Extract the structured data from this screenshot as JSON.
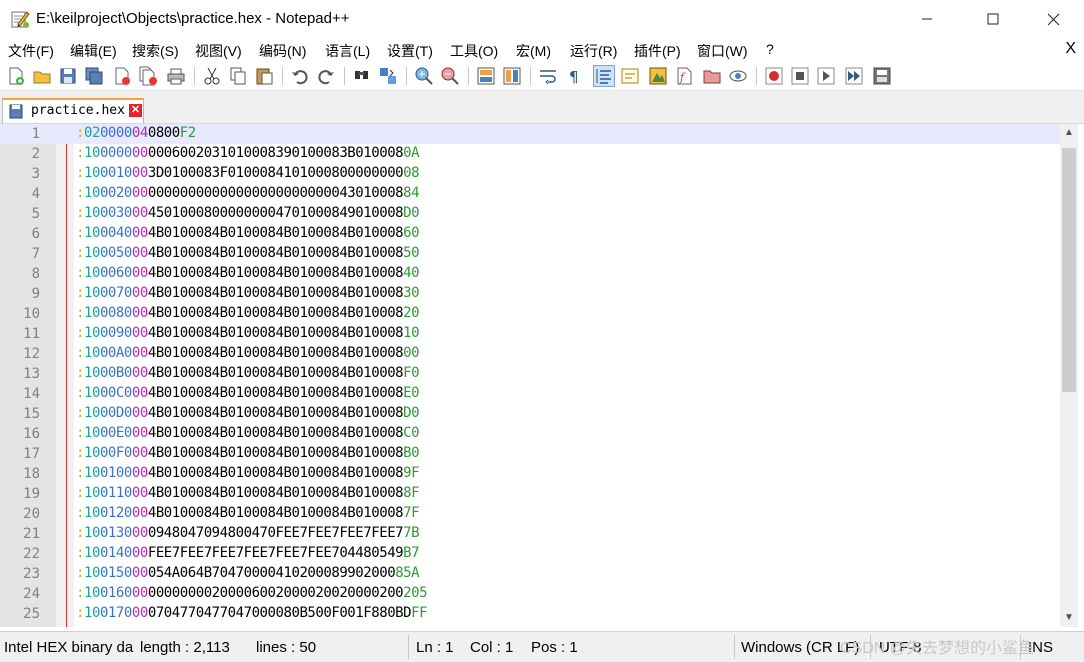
{
  "window": {
    "title": "E:\\keilproject\\Objects\\practice.hex - Notepad++",
    "minimize_glyph": "—",
    "maximize_glyph": "☐",
    "close_glyph": "✕"
  },
  "menu": {
    "items": [
      "文件(F)",
      "编辑(E)",
      "搜索(S)",
      "视图(V)",
      "编码(N)",
      "语言(L)",
      "设置(T)",
      "工具(O)",
      "宏(M)",
      "运行(R)",
      "插件(P)",
      "窗口(W)",
      "?"
    ],
    "close_glyph": "X"
  },
  "toolbar": {
    "icons": [
      "new-file-icon",
      "open-file-icon",
      "save-icon",
      "save-all-icon",
      "close-file-icon",
      "close-all-icon",
      "print-icon",
      "cut-icon",
      "copy-icon",
      "paste-icon",
      "undo-icon",
      "redo-icon",
      "find-icon",
      "replace-icon",
      "zoom-in-icon",
      "zoom-out-icon",
      "sync-vertical-icon",
      "sync-horizontal-icon",
      "word-wrap-icon",
      "show-all-chars-icon",
      "indent-guide-icon",
      "doc-map-icon",
      "function-list-icon",
      "folder-workspace-icon",
      "monitoring-icon",
      "eye-icon",
      "record-macro-icon",
      "stop-macro-icon",
      "play-macro-icon",
      "run-macro-multiple-icon",
      "save-macro-icon"
    ]
  },
  "tab": {
    "label": "practice.hex",
    "close_glyph": "✕"
  },
  "editor": {
    "lines": [
      {
        "n": "1",
        "colon": ":",
        "count": "02",
        "addr": "0000",
        "type": "04",
        "data": "0800",
        "chk": "F2"
      },
      {
        "n": "2",
        "colon": ":",
        "count": "10",
        "addr": "0000",
        "type": "00",
        "data": "0006002031010008390100083B010008",
        "chk": "0A"
      },
      {
        "n": "3",
        "colon": ":",
        "count": "10",
        "addr": "0010",
        "type": "00",
        "data": "3D0100083F0100084101000800000000",
        "chk": "08"
      },
      {
        "n": "4",
        "colon": ":",
        "count": "10",
        "addr": "0020",
        "type": "00",
        "data": "00000000000000000000000043010008",
        "chk": "84"
      },
      {
        "n": "5",
        "colon": ":",
        "count": "10",
        "addr": "0030",
        "type": "00",
        "data": "45010008000000004701000849010008",
        "chk": "D0"
      },
      {
        "n": "6",
        "colon": ":",
        "count": "10",
        "addr": "0040",
        "type": "00",
        "data": "4B0100084B0100084B0100084B010008",
        "chk": "60"
      },
      {
        "n": "7",
        "colon": ":",
        "count": "10",
        "addr": "0050",
        "type": "00",
        "data": "4B0100084B0100084B0100084B010008",
        "chk": "50"
      },
      {
        "n": "8",
        "colon": ":",
        "count": "10",
        "addr": "0060",
        "type": "00",
        "data": "4B0100084B0100084B0100084B010008",
        "chk": "40"
      },
      {
        "n": "9",
        "colon": ":",
        "count": "10",
        "addr": "0070",
        "type": "00",
        "data": "4B0100084B0100084B0100084B010008",
        "chk": "30"
      },
      {
        "n": "10",
        "colon": ":",
        "count": "10",
        "addr": "0080",
        "type": "00",
        "data": "4B0100084B0100084B0100084B010008",
        "chk": "20"
      },
      {
        "n": "11",
        "colon": ":",
        "count": "10",
        "addr": "0090",
        "type": "00",
        "data": "4B0100084B0100084B0100084B010008",
        "chk": "10"
      },
      {
        "n": "12",
        "colon": ":",
        "count": "10",
        "addr": "00A0",
        "type": "00",
        "data": "4B0100084B0100084B0100084B010008",
        "chk": "00"
      },
      {
        "n": "13",
        "colon": ":",
        "count": "10",
        "addr": "00B0",
        "type": "00",
        "data": "4B0100084B0100084B0100084B010008",
        "chk": "F0"
      },
      {
        "n": "14",
        "colon": ":",
        "count": "10",
        "addr": "00C0",
        "type": "00",
        "data": "4B0100084B0100084B0100084B010008",
        "chk": "E0"
      },
      {
        "n": "15",
        "colon": ":",
        "count": "10",
        "addr": "00D0",
        "type": "00",
        "data": "4B0100084B0100084B0100084B010008",
        "chk": "D0"
      },
      {
        "n": "16",
        "colon": ":",
        "count": "10",
        "addr": "00E0",
        "type": "00",
        "data": "4B0100084B0100084B0100084B010008",
        "chk": "C0"
      },
      {
        "n": "17",
        "colon": ":",
        "count": "10",
        "addr": "00F0",
        "type": "00",
        "data": "4B0100084B0100084B0100084B010008",
        "chk": "B0"
      },
      {
        "n": "18",
        "colon": ":",
        "count": "10",
        "addr": "0100",
        "type": "00",
        "data": "4B0100084B0100084B0100084B010008",
        "chk": "9F"
      },
      {
        "n": "19",
        "colon": ":",
        "count": "10",
        "addr": "0110",
        "type": "00",
        "data": "4B0100084B0100084B0100084B010008",
        "chk": "8F"
      },
      {
        "n": "20",
        "colon": ":",
        "count": "10",
        "addr": "0120",
        "type": "00",
        "data": "4B0100084B0100084B0100084B010008",
        "chk": "7F"
      },
      {
        "n": "21",
        "colon": ":",
        "count": "10",
        "addr": "0130",
        "type": "00",
        "data": "0948047094800470FEE7FEE7FEE7FEE7",
        "chk": "7B"
      },
      {
        "n": "22",
        "colon": ":",
        "count": "10",
        "addr": "0140",
        "type": "00",
        "data": "FEE7FEE7FEE7FEE7FEE7FEE704480549",
        "chk": "B7"
      },
      {
        "n": "23",
        "colon": ":",
        "count": "10",
        "addr": "0150",
        "type": "00",
        "data": "054A064B70470000410200089902000",
        "chk": "85A"
      },
      {
        "n": "24",
        "colon": ":",
        "count": "10",
        "addr": "0160",
        "type": "00",
        "data": "00000000200006002000020020000200",
        "chk": "205"
      },
      {
        "n": "25",
        "colon": ":",
        "count": "10",
        "addr": "0170",
        "type": "00",
        "data": "0704770477047000080B500F001F880BD",
        "chk": "FF"
      }
    ]
  },
  "status": {
    "file_type": "Intel HEX binary da",
    "length": "length : 2,113",
    "lines": "lines : 50",
    "ln": "Ln : 1",
    "col": "Col : 1",
    "pos": "Pos : 1",
    "eol": "Windows (CR LF)",
    "encoding": "UTF-8",
    "mode": "INS"
  },
  "watermark": "CSDN @失去梦想的小鲨鱼"
}
